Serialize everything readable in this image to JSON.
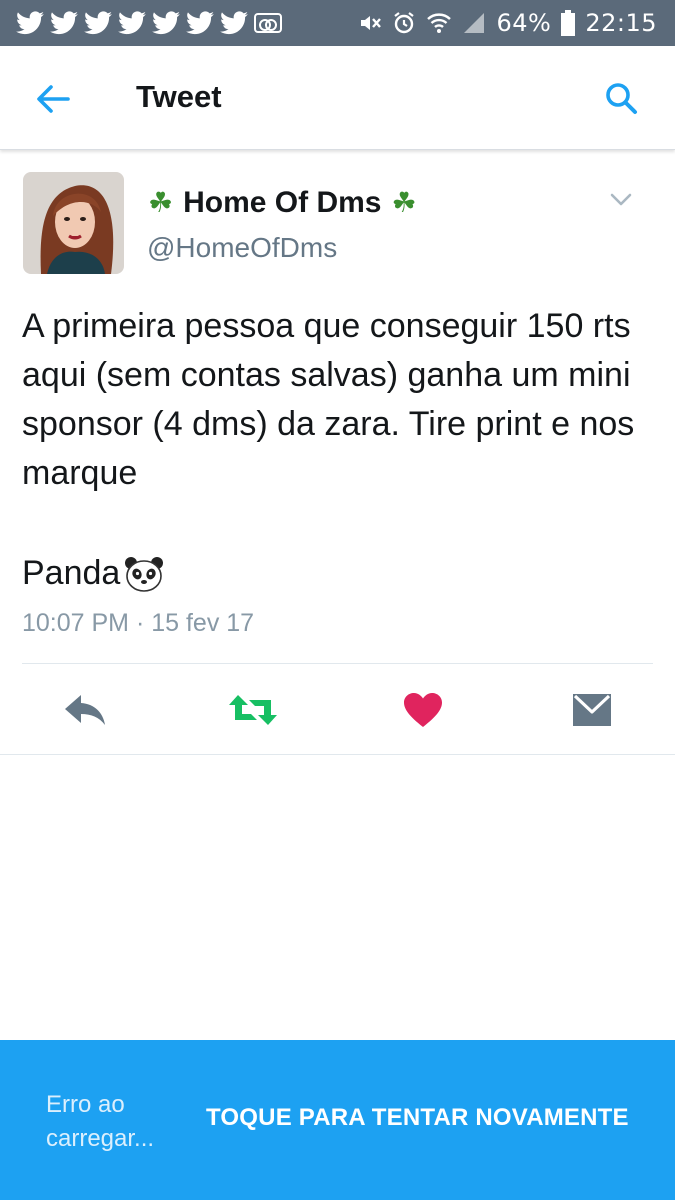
{
  "status_bar": {
    "notifications": [
      "twitter-icon",
      "twitter-icon",
      "twitter-icon",
      "twitter-icon",
      "twitter-icon",
      "twitter-icon",
      "twitter-icon",
      "voicemail-icon"
    ],
    "battery": "64%",
    "time": "22:15"
  },
  "header": {
    "title": "Tweet"
  },
  "tweet": {
    "display_name": "Home Of Dms",
    "name_decoration": "☘",
    "handle": "@HomeOfDms",
    "text": "A primeira pessoa que conseguir 150 rts aqui (sem contas salvas) ganha um mini sponsor (4 dms) da zara. Tire print e nos marque",
    "signature": "Panda",
    "timestamp": "10:07 PM · 15 fev 17"
  },
  "actions": [
    "reply-icon",
    "retweet-icon",
    "like-icon",
    "direct-message-icon"
  ],
  "error_banner": {
    "message": "Erro ao carregar...",
    "retry_label": "TOQUE PARA TENTAR NOVAMENTE"
  },
  "colors": {
    "status_bar": "#5b6a7a",
    "accent": "#1da1f2",
    "retweet": "#17bf63",
    "like": "#e0245e",
    "muted": "#657786"
  }
}
